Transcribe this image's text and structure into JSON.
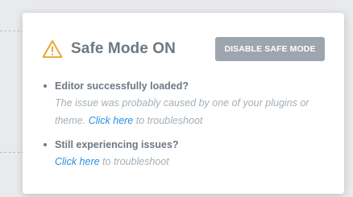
{
  "dialog": {
    "title": "Safe Mode ON",
    "icon": "warning-triangle-icon",
    "disable_button_label": "Disable Safe Mode",
    "accent_color": "#e6a32a",
    "link_color": "#2a8ee5"
  },
  "items": [
    {
      "title": "Editor successfully loaded?",
      "desc_line1": "The issue was probably caused by one of your plugins or",
      "desc_line2_prefix": "theme. ",
      "link_text": "Click here",
      "desc_suffix": " to troubleshoot"
    },
    {
      "title": "Still experiencing issues?",
      "link_text": "Click here",
      "desc_suffix": " to troubleshoot"
    }
  ]
}
